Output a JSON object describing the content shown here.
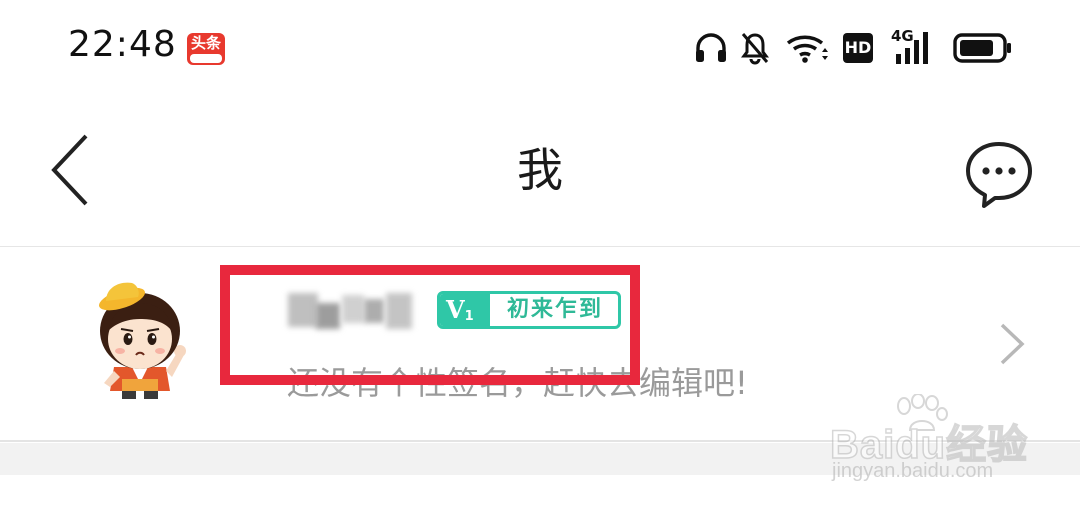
{
  "status_bar": {
    "time": "22:48",
    "app_badge": "头条",
    "network_label": "4G",
    "hd_label": "HD"
  },
  "header": {
    "title": "我"
  },
  "profile": {
    "level_badge": {
      "level_prefix": "V",
      "level_number": "1",
      "level_name": "初来乍到"
    },
    "signature": "还没有个性签名，赶快去编辑吧!"
  },
  "watermark": {
    "brand": "Baidu经验",
    "url": "jingyan.baidu.com"
  },
  "colors": {
    "accent_green": "#2fc7a7",
    "annotation_red": "#e8283d",
    "app_badge_red": "#e8392e"
  },
  "icons": {
    "back": "chevron-left-icon",
    "message": "chat-bubble-icon",
    "row_arrow": "chevron-right-icon",
    "headphones": "headphones-icon",
    "mute": "bell-off-icon",
    "wifi": "wifi-icon",
    "signal": "signal-icon",
    "battery": "battery-icon"
  }
}
